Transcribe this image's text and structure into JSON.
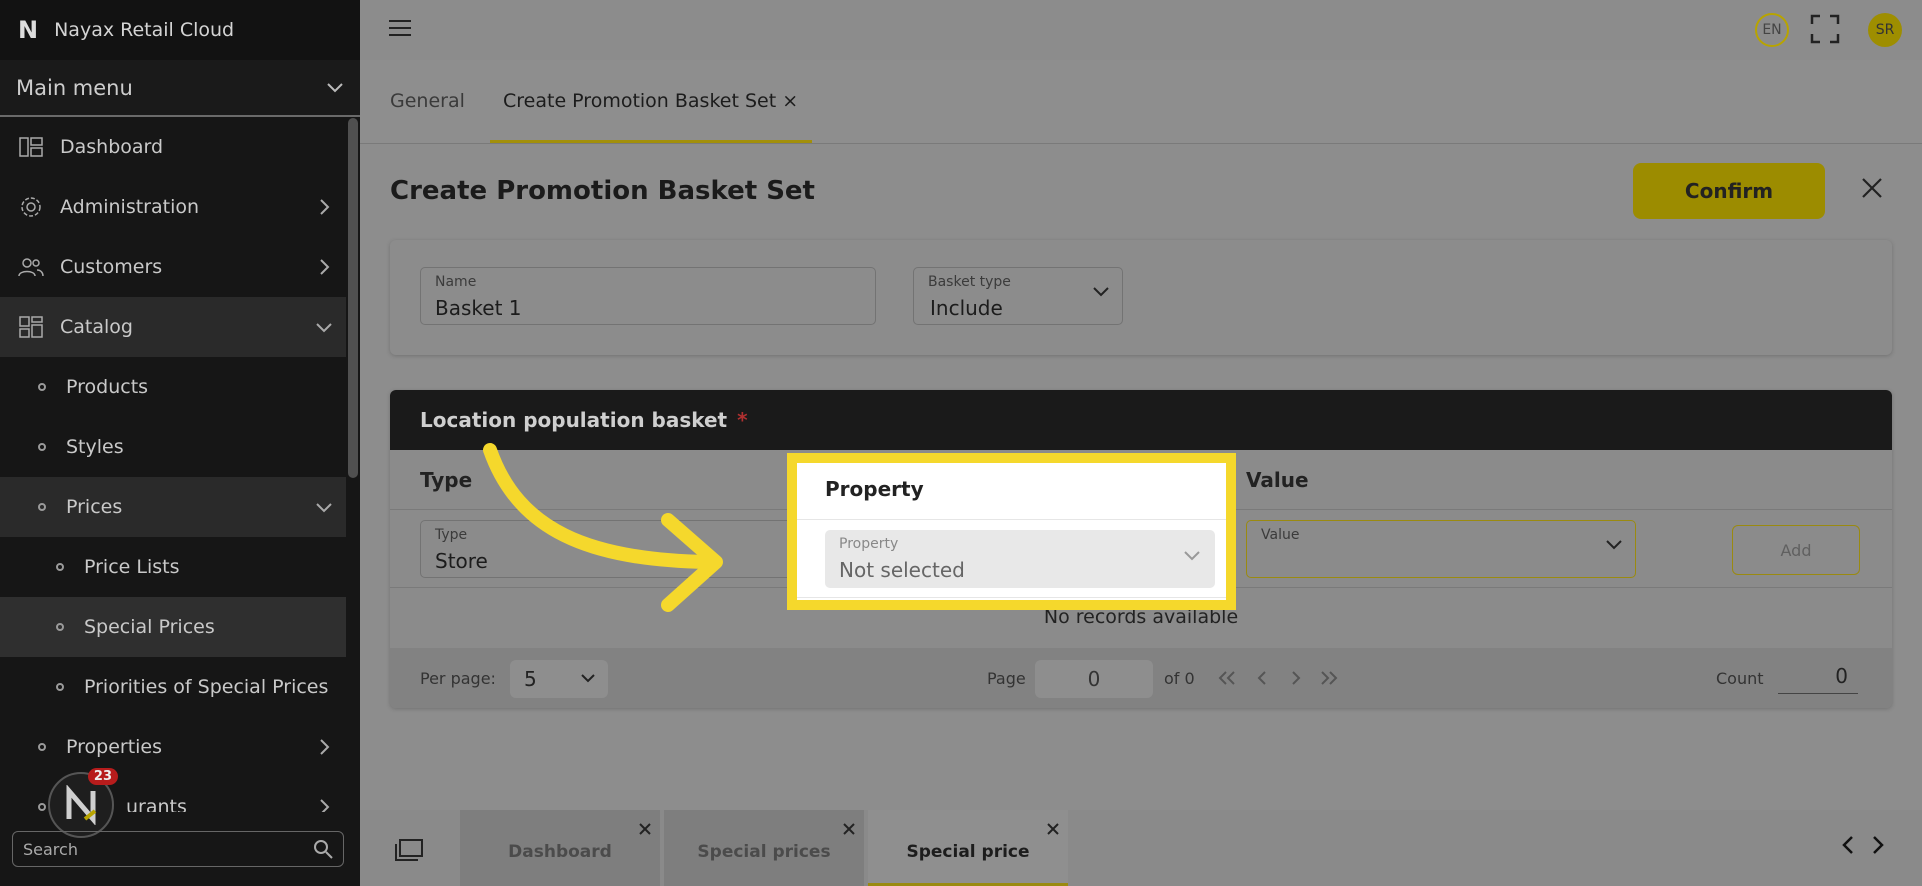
{
  "app": {
    "title": "Nayax Retail Cloud",
    "logo_letter": "N"
  },
  "sidebar": {
    "main_menu_label": "Main menu",
    "items": [
      {
        "label": "Dashboard",
        "icon": "dashboard-icon",
        "level": 0
      },
      {
        "label": "Administration",
        "icon": "gear-icon",
        "level": 0
      },
      {
        "label": "Customers",
        "icon": "users-icon",
        "level": 0
      },
      {
        "label": "Catalog",
        "icon": "grid-icon",
        "level": 0
      },
      {
        "label": "Products",
        "level": 1
      },
      {
        "label": "Styles",
        "level": 1
      },
      {
        "label": "Prices",
        "level": 1
      },
      {
        "label": "Price Lists",
        "level": 2
      },
      {
        "label": "Special Prices",
        "level": 2
      },
      {
        "label": "Priorities of Special Prices",
        "level": 2
      },
      {
        "label": "Properties",
        "level": 1
      },
      {
        "label": "urants",
        "level": 1
      }
    ],
    "search_placeholder": "Search",
    "notification_count": "23"
  },
  "topbar": {
    "language": "EN",
    "user_initials": "SR"
  },
  "tabs": [
    {
      "label": "General"
    },
    {
      "label": "Create Promotion Basket Set",
      "close": "×"
    }
  ],
  "page": {
    "title": "Create Promotion Basket Set",
    "confirm_label": "Confirm"
  },
  "form": {
    "name_label": "Name",
    "name_value": "Basket 1",
    "basket_type_label": "Basket type",
    "basket_type_value": "Include"
  },
  "basket": {
    "title": "Location population basket",
    "required_mark": "*",
    "columns": {
      "type": "Type",
      "property": "Property",
      "value": "Value"
    },
    "type_field_label": "Type",
    "type_field_value": "Store",
    "property_field_label": "Property",
    "property_field_value": "Not selected",
    "value_field_label": "Value",
    "add_label": "Add",
    "empty_text": "No records available",
    "per_page_label": "Per page:",
    "per_page_value": "5",
    "page_label": "Page",
    "page_value": "0",
    "page_of": "of 0",
    "count_label": "Count",
    "count_value": "0"
  },
  "bottom_tabs": [
    {
      "label": "Dashboard"
    },
    {
      "label": "Special prices"
    },
    {
      "label": "Special price"
    }
  ],
  "colors": {
    "highlight": "#f5d82c",
    "accent": "#9c8c00"
  }
}
